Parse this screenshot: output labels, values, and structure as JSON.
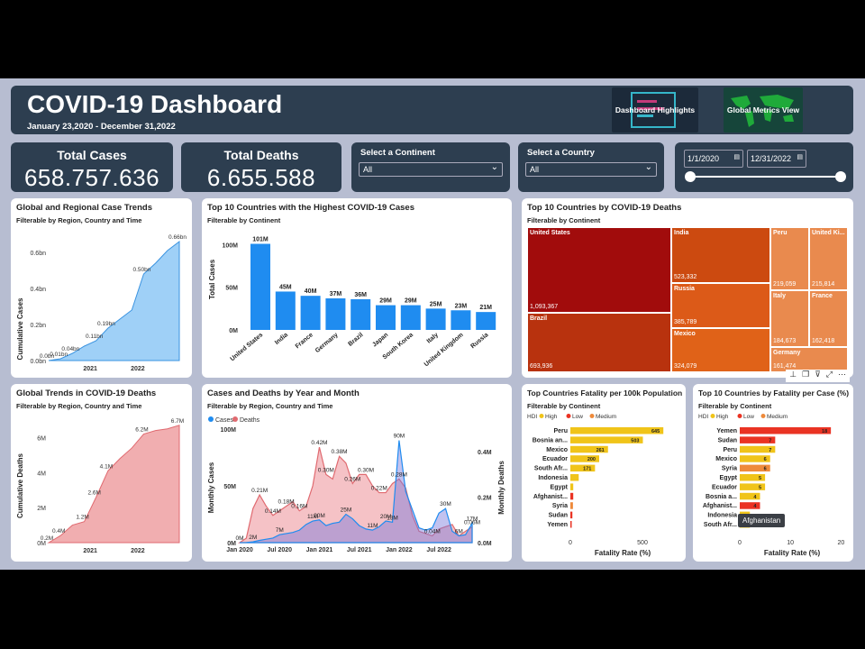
{
  "header": {
    "title": "COVID-19 Dashboard",
    "date_range": "January 23,2020 - December 31,2022",
    "nav_highlights": "Dashboard Highlights",
    "nav_global": "Global Metrics View"
  },
  "kpis": {
    "cases_label": "Total Cases",
    "cases_value": "658.757.636",
    "deaths_label": "Total Deaths",
    "deaths_value": "6.655.588"
  },
  "slicers": {
    "continent_label": "Select a Continent",
    "continent_value": "All",
    "country_label": "Select a Country",
    "country_value": "All",
    "date_start": "1/1/2020",
    "date_end": "12/31/2022"
  },
  "icons": {
    "dropdown": "chevron-down-icon",
    "calendar": "calendar-icon",
    "pin": "pin-icon",
    "copy": "copy-icon",
    "filter": "filter-icon",
    "focus": "focus-mode-icon",
    "more": "more-options-icon"
  },
  "colors": {
    "header_bg": "#2d3e50",
    "case_blue": "#1f8cf0",
    "death_red": "#e88a8a",
    "high": "#f0c419",
    "low": "#ea3323",
    "medium": "#ee8a3b"
  },
  "tooltip": "Afghanistan",
  "chart_data": [
    {
      "id": "case_trends",
      "type": "area",
      "title": "Global and Regional Case Trends",
      "subtitle": "Filterable by Region, Country and Time",
      "ylabel": "Cumulative Cases",
      "xticks": [
        "2021",
        "2022"
      ],
      "yticks": [
        "0.0bn",
        "0.2bn",
        "0.4bn",
        "0.6bn"
      ],
      "ylim": [
        0,
        0.7
      ],
      "x": [
        "2020-01",
        "2020-06",
        "2020-09",
        "2020-12",
        "2021-03",
        "2021-06",
        "2021-09",
        "2021-12",
        "2022-03",
        "2022-06",
        "2022-09",
        "2022-12"
      ],
      "values": [
        0.0,
        0.01,
        0.04,
        0.08,
        0.11,
        0.18,
        0.23,
        0.28,
        0.48,
        0.54,
        0.61,
        0.66
      ],
      "labels": [
        "0.0bn",
        "0.01bn",
        "0.04bn",
        "0.11bn",
        "0.19bn",
        "0.50bn",
        "0.66bn"
      ]
    },
    {
      "id": "top10_cases",
      "type": "bar",
      "title": "Top 10 Countries with the Highest COVID-19 Cases",
      "subtitle": "Filterable by Continent",
      "ylabel": "Total Cases",
      "yticks": [
        "0M",
        "50M",
        "100M"
      ],
      "ylim": [
        0,
        110
      ],
      "categories": [
        "United States",
        "India",
        "France",
        "Germany",
        "Brazil",
        "Japan",
        "South Korea",
        "Italy",
        "United Kingdom",
        "Russia"
      ],
      "values": [
        101,
        45,
        40,
        37,
        36,
        29,
        29,
        25,
        23,
        21
      ],
      "labels": [
        "101M",
        "45M",
        "40M",
        "37M",
        "36M",
        "29M",
        "29M",
        "25M",
        "23M",
        "21M"
      ]
    },
    {
      "id": "top10_deaths",
      "type": "treemap",
      "title": "Top 10 Countries by COVID-19 Deaths",
      "subtitle": "Filterable by Continent",
      "categories": [
        "United States",
        "Brazil",
        "India",
        "Russia",
        "Mexico",
        "Peru",
        "United Ki...",
        "Italy",
        "France",
        "Germany"
      ],
      "values": [
        1093367,
        693936,
        523332,
        385789,
        324079,
        219059,
        215814,
        184673,
        162418,
        161474
      ],
      "labels": [
        "1,093,367",
        "693,936",
        "523,332",
        "385,789",
        "324,079",
        "219,059",
        "215,814",
        "184,673",
        "162,418",
        "161,474"
      ]
    },
    {
      "id": "death_trends",
      "type": "area",
      "title": "Global Trends in COVID-19 Deaths",
      "subtitle": "Filterable by Region, Country and Time",
      "ylabel": "Cumulative Deaths",
      "xticks": [
        "2021",
        "2022"
      ],
      "yticks": [
        "0M",
        "2M",
        "4M",
        "6M"
      ],
      "ylim": [
        0,
        7
      ],
      "x": [
        "2020-01",
        "2020-06",
        "2020-09",
        "2020-12",
        "2021-03",
        "2021-06",
        "2021-09",
        "2021-12",
        "2022-03",
        "2022-06",
        "2022-09",
        "2022-12"
      ],
      "values": [
        0.0,
        0.4,
        1.0,
        1.2,
        2.6,
        4.1,
        4.8,
        5.4,
        6.2,
        6.4,
        6.5,
        6.7
      ],
      "labels": [
        "0.2M",
        "0.4M",
        "1.2M",
        "2.6M",
        "4.1M",
        "6.2M",
        "6.7M"
      ]
    },
    {
      "id": "monthly",
      "type": "area",
      "title": "Cases and Deaths by Year and Month",
      "subtitle": "Filterable by Region, Country and Time",
      "ylabel": "Monthly Cases",
      "y2label": "Monthly Deaths",
      "xticks": [
        "Jan 2020",
        "Jul 2020",
        "Jan 2021",
        "Jul 2021",
        "Jan 2022",
        "Jul 2022"
      ],
      "yticks": [
        "0M",
        "50M",
        "100M"
      ],
      "y2ticks": [
        "0.0M",
        "0.2M",
        "0.4M"
      ],
      "series": [
        {
          "name": "Cases",
          "values": [
            0,
            0.1,
            0.7,
            2,
            3,
            4,
            7,
            8,
            9,
            11,
            16,
            19,
            20,
            15,
            17,
            18,
            25,
            21,
            15,
            12,
            11,
            14,
            19,
            18,
            90,
            45,
            29,
            13,
            11,
            13,
            26,
            30,
            10,
            6,
            7,
            17
          ]
        },
        {
          "name": "Deaths",
          "values": [
            0,
            0.02,
            0.15,
            0.21,
            0.16,
            0.12,
            0.14,
            0.16,
            0.18,
            0.14,
            0.16,
            0.25,
            0.42,
            0.3,
            0.28,
            0.38,
            0.35,
            0.26,
            0.3,
            0.3,
            0.25,
            0.22,
            0.22,
            0.26,
            0.28,
            0.24,
            0.12,
            0.05,
            0.04,
            0.03,
            0.06,
            0.07,
            0.08,
            0.03,
            0.05,
            0.07
          ]
        }
      ],
      "labels": [
        "0M",
        "2M",
        "7M",
        "11M",
        "11M",
        "13M",
        "20M",
        "25M",
        "20M",
        "90M",
        "30M",
        "6M",
        "17M",
        "0.21M",
        "0.14M",
        "0.18M",
        "0.16M",
        "0.42M",
        "0.30M",
        "0.38M",
        "0.26M",
        "0.30M",
        "0.22M",
        "0.28M",
        "0.04M",
        "0.06M",
        "0.12M"
      ]
    },
    {
      "id": "fatality_100k",
      "type": "bar",
      "orientation": "horizontal",
      "title": "Top Countries Fatality per 100k Population",
      "subtitle": "Filterable by Continent",
      "legend_title": "HDI",
      "legend": [
        "High",
        "Low",
        "Medium"
      ],
      "xlabel": "Fatality Rate (%)",
      "xticks": [
        "0",
        "500"
      ],
      "xlim": [
        0,
        700
      ],
      "categories": [
        "Peru",
        "Bosnia an...",
        "Mexico",
        "Ecuador",
        "South Afr...",
        "Indonesia",
        "Egypt",
        "Afghanist...",
        "Syria",
        "Sudan",
        "Yemen"
      ],
      "values": [
        645,
        503,
        261,
        200,
        171,
        58,
        20,
        20,
        18,
        14,
        9
      ],
      "hdi": [
        "High",
        "High",
        "High",
        "High",
        "High",
        "High",
        "High",
        "Low",
        "Medium",
        "Low",
        "Low"
      ],
      "labels": [
        "645",
        "503",
        "261",
        "200",
        "171"
      ]
    },
    {
      "id": "fatality_case",
      "type": "bar",
      "orientation": "horizontal",
      "title": "Top 10 Countries by Fatality per Case (%)",
      "subtitle": "Filterable by Continent",
      "legend_title": "HDI",
      "legend": [
        "High",
        "Low",
        "Medium"
      ],
      "xlabel": "Fatality Rate (%)",
      "xticks": [
        "0",
        "10",
        "20"
      ],
      "xlim": [
        0,
        21
      ],
      "categories": [
        "Yemen",
        "Sudan",
        "Peru",
        "Mexico",
        "Syria",
        "Egypt",
        "Ecuador",
        "Bosnia a...",
        "Afghanist...",
        "Indonesia",
        "South Afr..."
      ],
      "values": [
        18,
        7,
        7,
        6,
        6,
        5,
        5,
        4,
        4,
        2,
        2
      ],
      "hdi": [
        "Low",
        "Low",
        "High",
        "High",
        "Medium",
        "High",
        "High",
        "High",
        "Low",
        "High",
        "High"
      ],
      "labels": [
        "18",
        "7",
        "7",
        "6",
        "6",
        "5",
        "5",
        "4",
        "4"
      ]
    }
  ]
}
